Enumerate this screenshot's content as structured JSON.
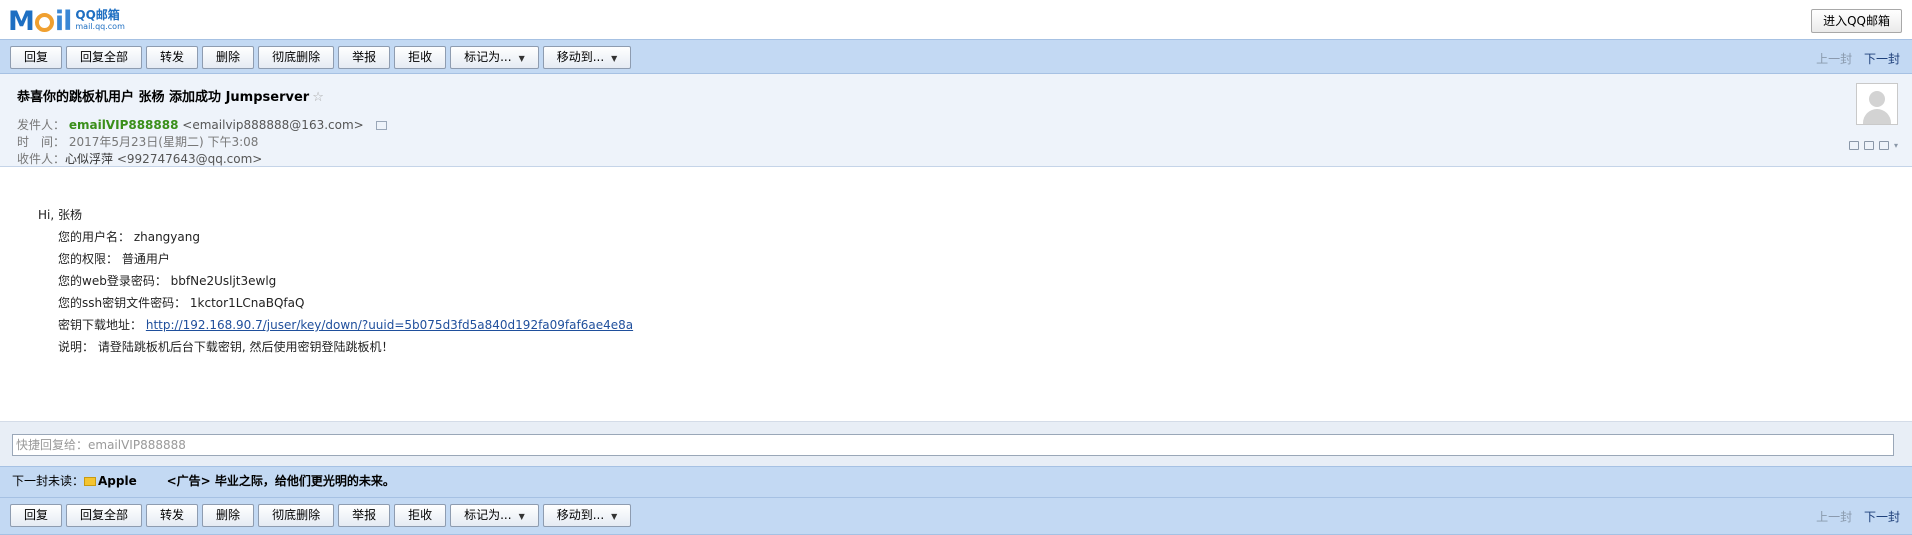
{
  "logo": {
    "brand_m": "M",
    "brand_il": "il",
    "service": "QQ邮箱",
    "domain": "mail.qq.com"
  },
  "top": {
    "enter_label": "进入QQ邮箱"
  },
  "toolbar": {
    "reply": "回复",
    "reply_all": "回复全部",
    "forward": "转发",
    "delete": "删除",
    "delete_forever": "彻底删除",
    "report": "举报",
    "reject": "拒收",
    "mark_as": "标记为...",
    "move_to": "移动到...",
    "prev_mail": "上一封",
    "next_mail": "下一封"
  },
  "email": {
    "subject": "恭喜你的跳板机用户 张杨 添加成功 Jumpserver",
    "from_label": "发件人：",
    "from_name": "emailVIP888888",
    "from_addr": "<emailvip888888@163.com>",
    "time_label": "时　间：",
    "time_value": "2017年5月23日(星期二) 下午3:08",
    "to_label": "收件人：",
    "to_name": "心似浮萍",
    "to_addr": "<992747643@qq.com>"
  },
  "body": {
    "greeting": "Hi, 张杨",
    "username_line": "您的用户名： zhangyang",
    "role_line": "您的权限： 普通用户",
    "web_pwd_line": "您的web登录密码： bbfNe2Usljt3ewlg",
    "ssh_pwd_line": "您的ssh密钥文件密码： 1kctor1LCnaBQfaQ",
    "key_url_label": "密钥下载地址：",
    "key_url": "http://192.168.90.7/juser/key/down/?uuid=5b075d3fd5a840d192fa09faf6ae4e8a",
    "note_line": "说明： 请登陆跳板机后台下载密钥, 然后使用密钥登陆跳板机！"
  },
  "quick_reply": {
    "placeholder": "快捷回复给：emailVIP888888"
  },
  "next_unread": {
    "label": "下一封未读：",
    "from": "Apple",
    "ad_text": "<广告> 毕业之际，给他们更光明的未来。"
  }
}
